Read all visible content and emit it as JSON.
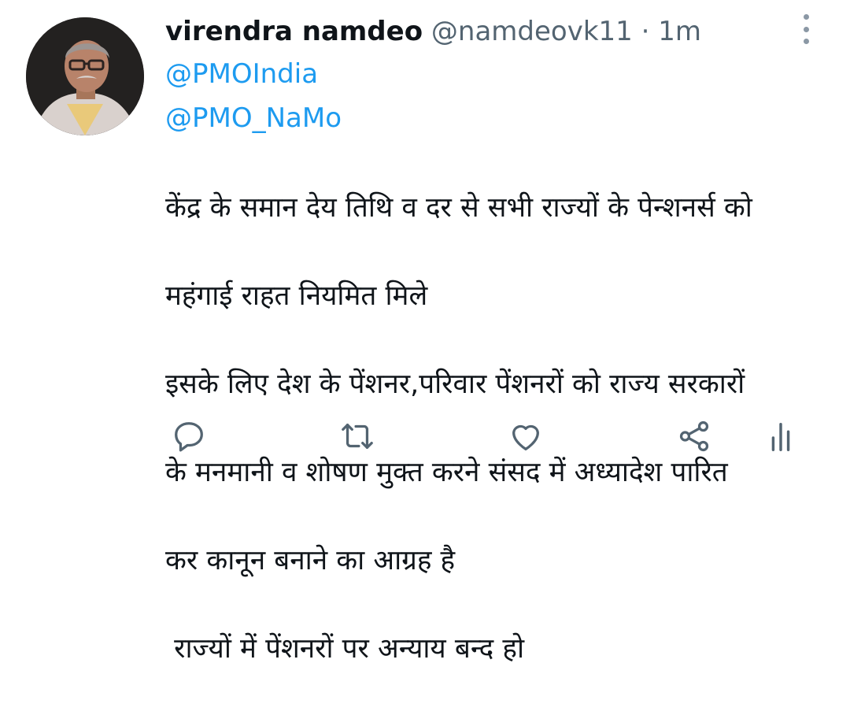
{
  "tweet": {
    "author_name": "virendra namdeo",
    "author_handle": "@namdeovk11",
    "separator": "·",
    "timestamp": "1m",
    "mentions": [
      "@PMOIndia",
      "@PMO_NaMo"
    ],
    "body_lines": [
      "केंद्र के समान देय तिथि व दर से सभी राज्यों के पेन्शनर्स को",
      "महंगाई राहत नियमित मिले",
      "इसके लिए देश के पेंशनर,परिवार पेंशनरों को राज्य सरकारों",
      "के मनमानी व शोषण मुक्त करने संसद में अध्यादेश पारित",
      "कर कानून बनाने का आग्रह है",
      " राज्यों में पेंशनरों पर अन्याय बन्द हो"
    ]
  },
  "icons": {
    "more": "more-vertical-icon",
    "reply": "reply-icon",
    "retweet": "retweet-icon",
    "like": "heart-icon",
    "share": "share-icon",
    "analytics": "analytics-icon"
  },
  "colors": {
    "mention": "#1d9bf0",
    "secondary_text": "#536471",
    "icon": "#536471"
  }
}
